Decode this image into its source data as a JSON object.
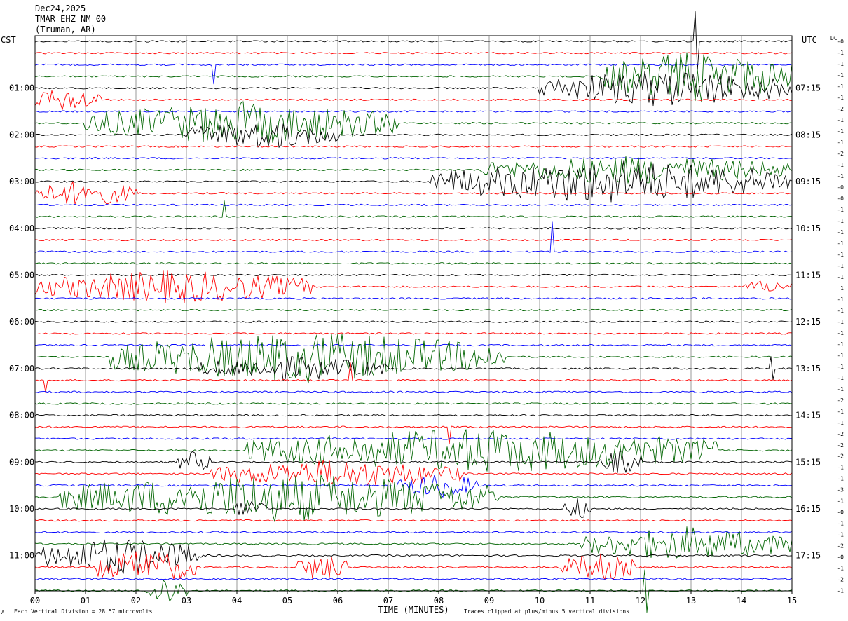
{
  "header": {
    "date": "Dec24,2025",
    "station": "TMAR EHZ NM 00",
    "location": "(Truman, AR)"
  },
  "left_tz": "CST",
  "right_tz": "UTC",
  "dc_label": "DC",
  "footer": {
    "scale_note": "Each Vertical Division =   28.57 microvolts",
    "clip_note": "Traces clipped at plus/minus 5 vertical divisions",
    "corner_mark": "A"
  },
  "chart_data": {
    "type": "line",
    "subtype": "helicorder",
    "xlabel": "TIME (MINUTES)",
    "xlim": [
      0,
      15
    ],
    "x_ticks": [
      "00",
      "01",
      "02",
      "03",
      "04",
      "05",
      "06",
      "07",
      "08",
      "09",
      "10",
      "11",
      "12",
      "13",
      "14",
      "15"
    ],
    "grid": true,
    "trace_count": 48,
    "trace_minutes": 15,
    "trace_colors": [
      "#000000",
      "#ff0000",
      "#0000ff",
      "#006400"
    ],
    "left_hour_labels": [
      {
        "trace": 4,
        "label": "01:00"
      },
      {
        "trace": 8,
        "label": "02:00"
      },
      {
        "trace": 12,
        "label": "03:00"
      },
      {
        "trace": 16,
        "label": "04:00"
      },
      {
        "trace": 20,
        "label": "05:00"
      },
      {
        "trace": 24,
        "label": "06:00"
      },
      {
        "trace": 28,
        "label": "07:00"
      },
      {
        "trace": 32,
        "label": "08:00"
      },
      {
        "trace": 36,
        "label": "09:00"
      },
      {
        "trace": 40,
        "label": "10:00"
      },
      {
        "trace": 44,
        "label": "11:00"
      }
    ],
    "right_hour_labels": [
      {
        "trace": 4,
        "label": "07:15"
      },
      {
        "trace": 8,
        "label": "08:15"
      },
      {
        "trace": 12,
        "label": "09:15"
      },
      {
        "trace": 16,
        "label": "10:15"
      },
      {
        "trace": 20,
        "label": "11:15"
      },
      {
        "trace": 24,
        "label": "12:15"
      },
      {
        "trace": 28,
        "label": "13:15"
      },
      {
        "trace": 32,
        "label": "14:15"
      },
      {
        "trace": 36,
        "label": "15:15"
      },
      {
        "trace": 40,
        "label": "16:15"
      },
      {
        "trace": 44,
        "label": "17:15"
      }
    ],
    "dc_offsets": [
      "-0",
      "-1",
      "-1",
      "-1",
      "-1",
      "-1",
      "-2",
      "-1",
      "-1",
      "-1",
      "-2",
      "-1",
      "-1",
      "-0",
      "-0",
      "-1",
      "-1",
      "-1",
      "-1",
      "-1",
      "-1",
      "-1",
      "1",
      "-1",
      "-1",
      "-1",
      "-1",
      "-1",
      "-1",
      "-1",
      "-1",
      "-1",
      "-2",
      "-1",
      "-1",
      "-2",
      "-2",
      "-2",
      "-1",
      "-1",
      "-3",
      "-1",
      "-0",
      "-1",
      "-1",
      "-2",
      "-0",
      "-1",
      "-2",
      "-1"
    ],
    "activity": [
      {
        "trace": 3,
        "start": 11.2,
        "end": 15.0,
        "amp": 2.2
      },
      {
        "trace": 4,
        "start": 10.0,
        "end": 15.0,
        "amp": 1.6
      },
      {
        "trace": 5,
        "start": 0.0,
        "end": 1.3,
        "amp": 1.0
      },
      {
        "trace": 7,
        "start": 1.0,
        "end": 7.2,
        "amp": 1.8
      },
      {
        "trace": 8,
        "start": 3.0,
        "end": 6.0,
        "amp": 1.2
      },
      {
        "trace": 11,
        "start": 8.8,
        "end": 15.0,
        "amp": 1.2
      },
      {
        "trace": 12,
        "start": 7.8,
        "end": 15.0,
        "amp": 1.9
      },
      {
        "trace": 13,
        "start": 0.0,
        "end": 2.0,
        "amp": 1.1
      },
      {
        "trace": 21,
        "start": 0.0,
        "end": 5.5,
        "amp": 1.4
      },
      {
        "trace": 21,
        "start": 14.0,
        "end": 15.0,
        "amp": 0.5
      },
      {
        "trace": 27,
        "start": 1.5,
        "end": 9.3,
        "amp": 2.2
      },
      {
        "trace": 28,
        "start": 3.2,
        "end": 7.0,
        "amp": 1.0
      },
      {
        "trace": 35,
        "start": 4.2,
        "end": 13.5,
        "amp": 1.9
      },
      {
        "trace": 36,
        "start": 2.8,
        "end": 3.5,
        "amp": 0.9
      },
      {
        "trace": 36,
        "start": 11.2,
        "end": 12.0,
        "amp": 1.0
      },
      {
        "trace": 37,
        "start": 3.5,
        "end": 8.5,
        "amp": 1.2
      },
      {
        "trace": 38,
        "start": 7.2,
        "end": 8.8,
        "amp": 1.0
      },
      {
        "trace": 39,
        "start": 0.5,
        "end": 9.2,
        "amp": 2.1
      },
      {
        "trace": 40,
        "start": 4.0,
        "end": 4.6,
        "amp": 0.9
      },
      {
        "trace": 40,
        "start": 10.5,
        "end": 11.0,
        "amp": 0.9
      },
      {
        "trace": 43,
        "start": 10.8,
        "end": 15.0,
        "amp": 1.4
      },
      {
        "trace": 44,
        "start": 0.0,
        "end": 3.3,
        "amp": 1.6
      },
      {
        "trace": 45,
        "start": 1.2,
        "end": 3.2,
        "amp": 1.5
      },
      {
        "trace": 45,
        "start": 5.2,
        "end": 6.2,
        "amp": 1.2
      },
      {
        "trace": 45,
        "start": 10.4,
        "end": 11.9,
        "amp": 1.2
      },
      {
        "trace": 47,
        "start": 2.2,
        "end": 3.0,
        "amp": 1.3
      }
    ],
    "spikes": [
      {
        "trace": 0,
        "x": 13.1,
        "amp": 2.5
      },
      {
        "trace": 2,
        "x": 3.55,
        "amp": 1.6
      },
      {
        "trace": 15,
        "x": 3.75,
        "amp": 1.3
      },
      {
        "trace": 18,
        "x": 10.25,
        "amp": 2.6
      },
      {
        "trace": 29,
        "x": 0.2,
        "amp": 1.0
      },
      {
        "trace": 29,
        "x": 6.25,
        "amp": 1.5
      },
      {
        "trace": 28,
        "x": 14.6,
        "amp": 1.0
      },
      {
        "trace": 33,
        "x": 8.2,
        "amp": 1.4
      },
      {
        "trace": 47,
        "x": 12.1,
        "amp": 1.8
      }
    ]
  }
}
